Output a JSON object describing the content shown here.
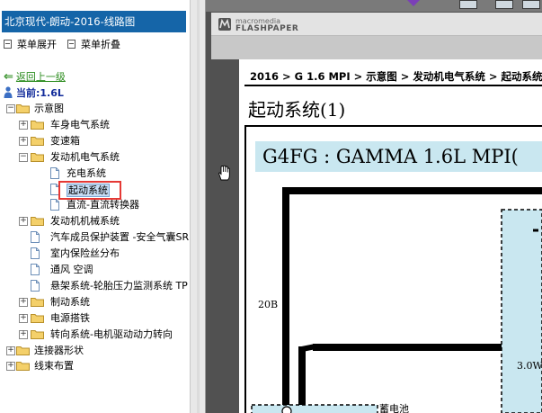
{
  "left_panel": {
    "title": "北京现代-朗动-2016-线路图",
    "toolbar": {
      "expand_label": "菜单展开",
      "collapse_label": "菜单折叠"
    },
    "back_link": "返回上一级",
    "current_label": "当前:1.6L",
    "tree": [
      {
        "label": "示意图",
        "toggle": "−",
        "type": "folder"
      },
      {
        "label": "车身电气系统",
        "toggle": "+",
        "type": "folder"
      },
      {
        "label": "变速箱",
        "toggle": "+",
        "type": "folder"
      },
      {
        "label": "发动机电气系统",
        "toggle": "−",
        "type": "folder"
      },
      {
        "label": "充电系统",
        "toggle": "",
        "type": "doc"
      },
      {
        "label": "起动系统",
        "toggle": "",
        "type": "doc",
        "selected": true
      },
      {
        "label": "直流-直流转换器",
        "toggle": "",
        "type": "doc"
      },
      {
        "label": "发动机机械系统",
        "toggle": "+",
        "type": "folder"
      },
      {
        "label": "汽车成员保护装置 -安全气囊SR",
        "toggle": "",
        "type": "doc"
      },
      {
        "label": "室内保险丝分布",
        "toggle": "",
        "type": "doc"
      },
      {
        "label": "通风 空调",
        "toggle": "",
        "type": "doc"
      },
      {
        "label": "悬架系统-轮胎压力监测系统 TP",
        "toggle": "",
        "type": "doc"
      },
      {
        "label": "制动系统",
        "toggle": "+",
        "type": "folder"
      },
      {
        "label": "电源搭铁",
        "toggle": "+",
        "type": "folder"
      },
      {
        "label": "转向系统-电机驱动动力转向",
        "toggle": "+",
        "type": "folder"
      },
      {
        "label": "连接器形状",
        "toggle": "+",
        "type": "folder"
      },
      {
        "label": "线束布置",
        "toggle": "+",
        "type": "folder"
      }
    ]
  },
  "viewer": {
    "brand_top": "macromedia",
    "brand_bottom": "FLASHPAPER",
    "breadcrumb": "2016 > G 1.6 MPI > 示意图 > 发动机电气系统 > 起动系统 >",
    "section_title": "起动系统(1)",
    "diagram_title": "G4FG : GAMMA 1.6L MPI(",
    "label_20b": "20B",
    "label_3w": "3.0W",
    "label_battery": "蓄电池"
  },
  "colors": {
    "title_bar": "#1565a8",
    "selection_box": "#e53935",
    "link_green": "#2c8c1f",
    "current_blue": "#102a9a",
    "diagram_fill": "#c9e7f0"
  },
  "icons": {
    "folder": "folder-icon",
    "document": "document-icon",
    "back": "back-arrow-icon",
    "current": "person-icon",
    "hand_cursor": "hand-cursor-icon"
  }
}
